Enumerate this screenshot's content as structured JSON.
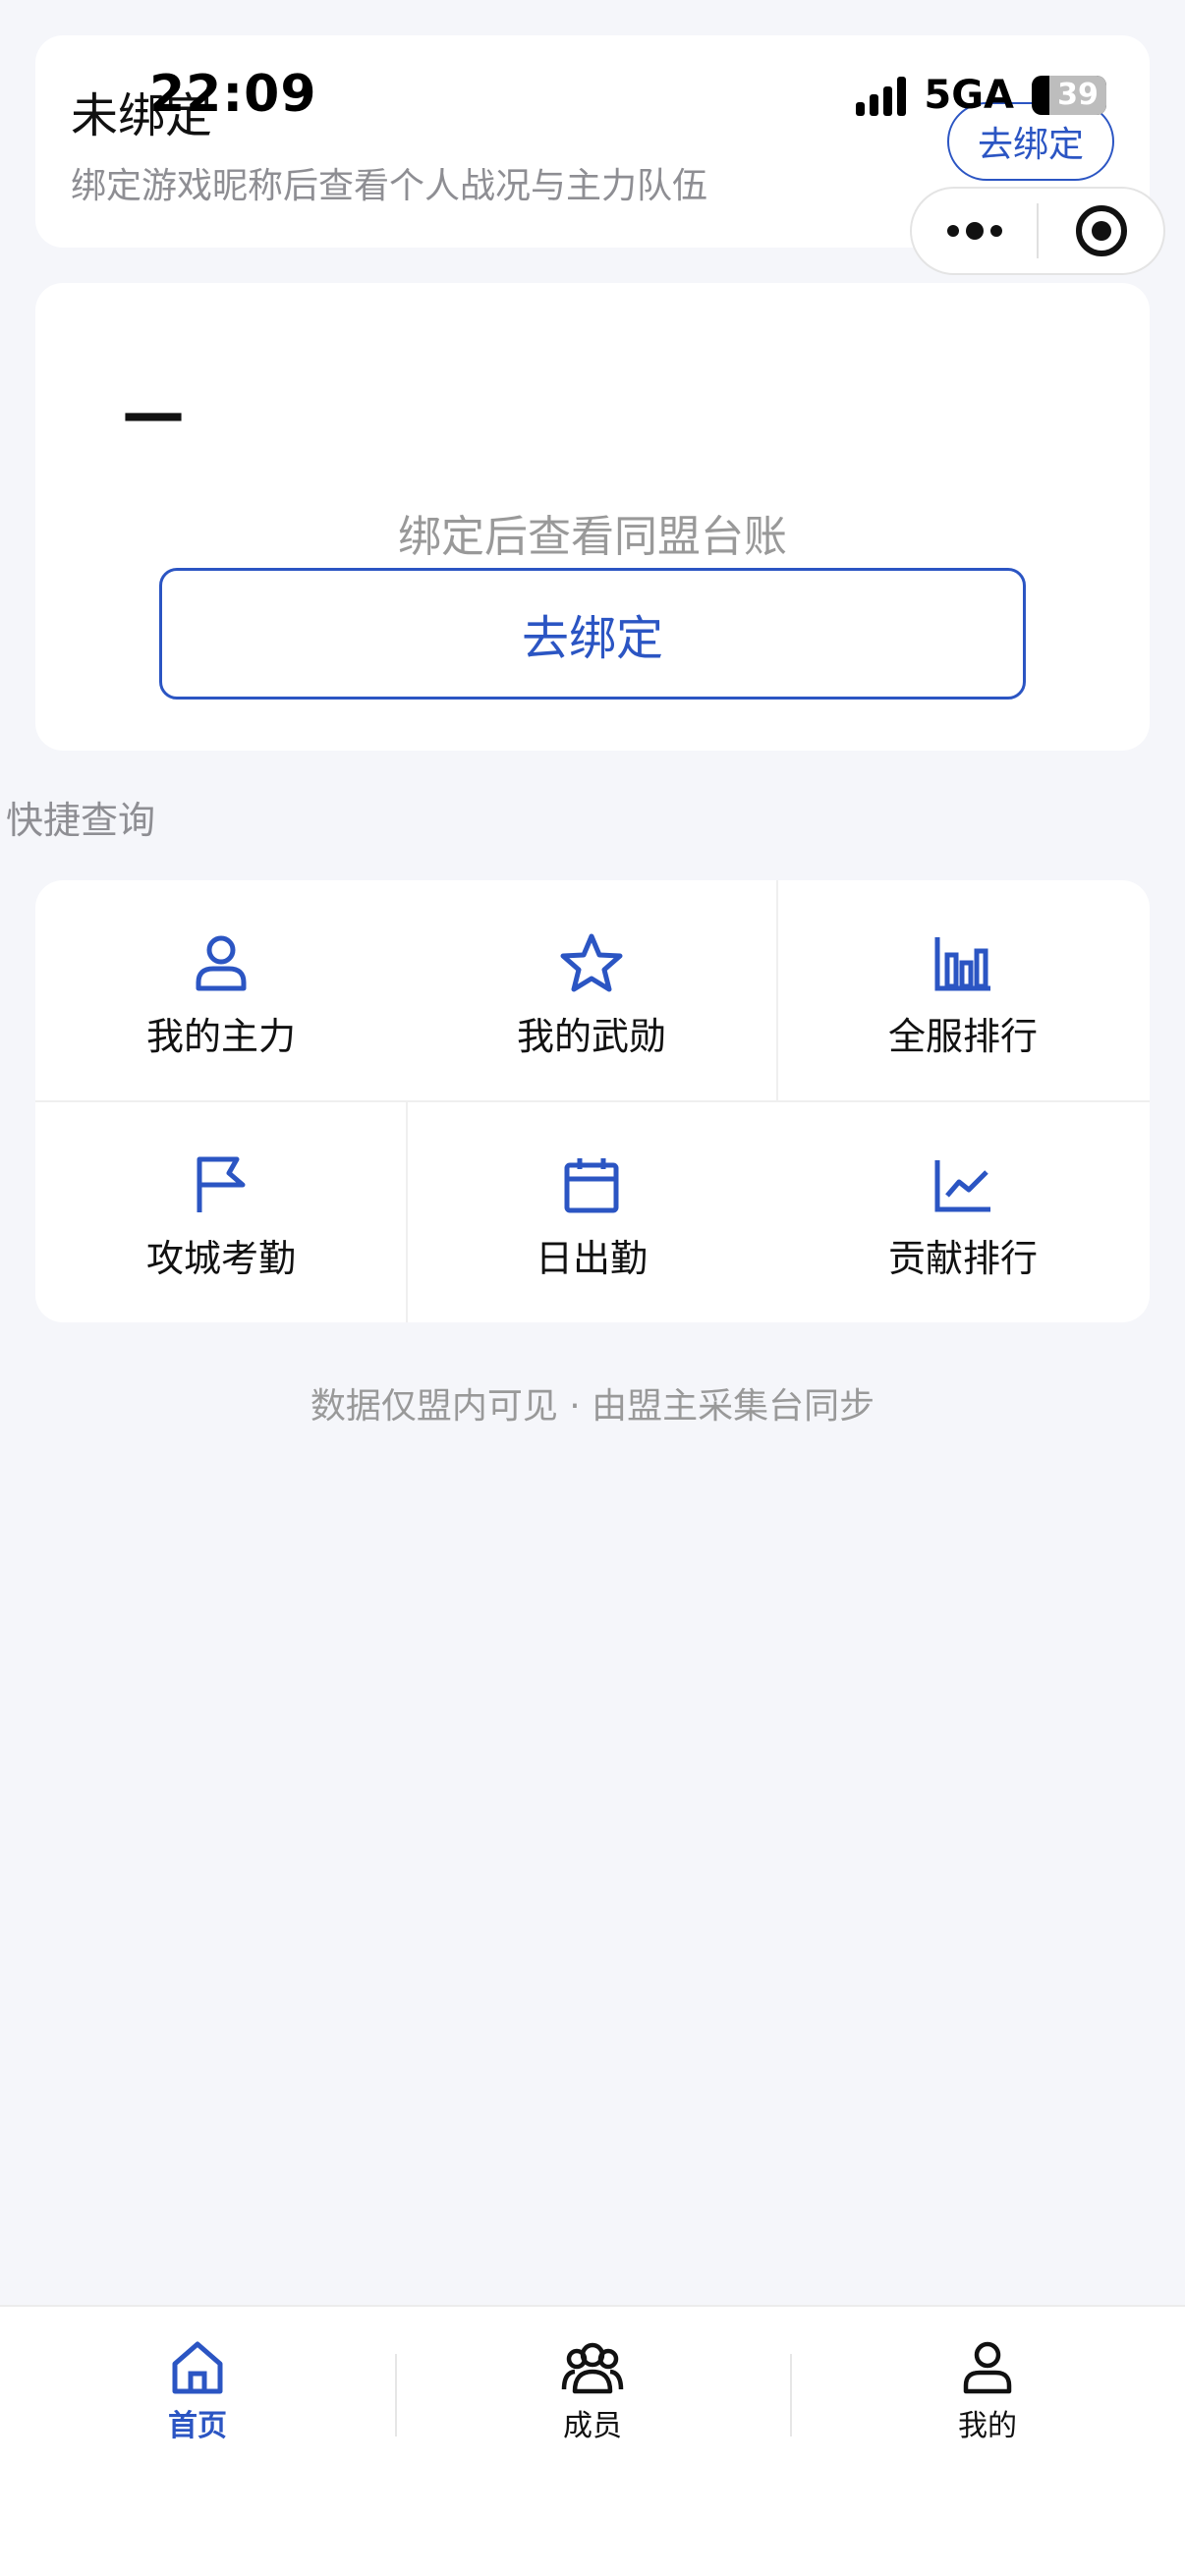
{
  "status_bar": {
    "time": "22:09",
    "network": "5GA",
    "battery": "39"
  },
  "profile": {
    "status": "未绑定",
    "hint": "绑定游戏昵称后查看个人战况与主力队伍",
    "bind_button": "去绑定"
  },
  "ledger": {
    "value": "—",
    "hint": "绑定后查看同盟台账",
    "bind_button": "去绑定"
  },
  "quick": {
    "title": "快捷查询",
    "items": [
      {
        "label": "我的主力",
        "icon": "user-icon"
      },
      {
        "label": "我的武勋",
        "icon": "star-icon"
      },
      {
        "label": "全服排行",
        "icon": "bar-chart-icon"
      },
      {
        "label": "攻城考勤",
        "icon": "flag-icon"
      },
      {
        "label": "日出勤",
        "icon": "calendar-icon"
      },
      {
        "label": "贡献排行",
        "icon": "line-chart-icon"
      }
    ]
  },
  "footer_note": "数据仅盟内可见 · 由盟主采集台同步",
  "tabs": [
    {
      "label": "首页",
      "icon": "home-icon",
      "active": true
    },
    {
      "label": "成员",
      "icon": "members-icon",
      "active": false
    },
    {
      "label": "我的",
      "icon": "profile-icon",
      "active": false
    }
  ],
  "colors": {
    "accent": "#2b55c3",
    "background": "#f5f6fa",
    "muted": "#8e8e93"
  }
}
